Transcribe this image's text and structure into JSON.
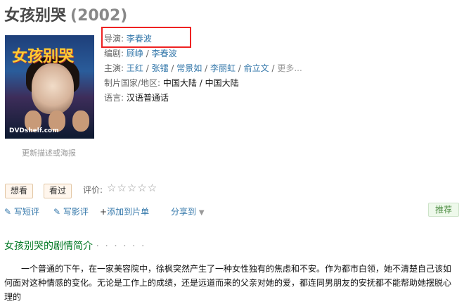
{
  "title": "女孩别哭",
  "year": "(2002)",
  "poster": {
    "title_text": "女孩别哭",
    "brand": "DVDshelf.com"
  },
  "update_link": "更新描述或海报",
  "info": {
    "director_label": "导演:",
    "director": "李春波",
    "writer_label": "编剧:",
    "writers": [
      "顾峥",
      "李春波"
    ],
    "cast_label": "主演:",
    "cast": [
      "王红",
      "张镭",
      "常景如",
      "李丽虹",
      "俞立文"
    ],
    "cast_more": "更多...",
    "country_label": "制片国家/地区:",
    "country": "中国大陆 / 中国大陆",
    "language_label": "语言:",
    "language": "汉语普通话"
  },
  "buttons": {
    "want": "想看",
    "seen": "看过",
    "rating_label": "评价:",
    "stars": "☆☆☆☆☆"
  },
  "actions": {
    "short_review": "写短评",
    "review": "写影评",
    "add_list": "添加到片单",
    "share": "分享到",
    "recommend": "推荐"
  },
  "section": {
    "title": "女孩别哭的剧情简介",
    "dots": "· · · · · ·"
  },
  "summary": "一个普通的下午，在一家美容院中，徐枫突然产生了一种女性独有的焦虑和不安。作为都市白领，她不清楚自己该如何面对这种情感的变化。无论是工作上的成绩，还是远道而来的父亲对她的爱，都连同男朋友的安抚都不能帮助她摆脱心理的"
}
